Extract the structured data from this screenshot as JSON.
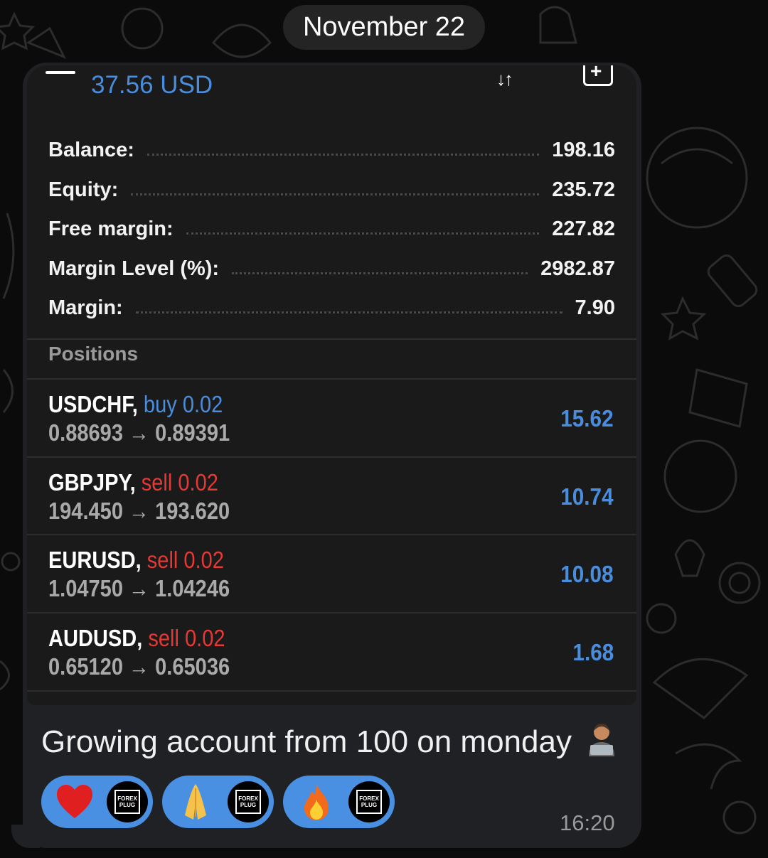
{
  "date_separator": "November 22",
  "screenshot": {
    "top_balance": "37.56 USD",
    "summary": [
      {
        "label": "Balance:",
        "value": "198.16"
      },
      {
        "label": "Equity:",
        "value": "235.72"
      },
      {
        "label": "Free margin:",
        "value": "227.82"
      },
      {
        "label": "Margin Level (%):",
        "value": "2982.87"
      },
      {
        "label": "Margin:",
        "value": "7.90"
      }
    ],
    "positions_header": "Positions",
    "positions": [
      {
        "symbol": "USDCHF,",
        "side": "buy 0.02",
        "prices": "0.88693 → 0.89391",
        "profit": "15.62"
      },
      {
        "symbol": "GBPJPY,",
        "side": "sell 0.02",
        "prices": "194.450 → 193.620",
        "profit": "10.74"
      },
      {
        "symbol": "EURUSD,",
        "side": "sell 0.02",
        "prices": "1.04750 → 1.04246",
        "profit": "10.08"
      },
      {
        "symbol": "AUDUSD,",
        "side": "sell 0.02",
        "prices": "0.65120 → 0.65036",
        "profit": "1.68"
      }
    ]
  },
  "message": {
    "caption": "Growing account from 100 on monday",
    "time": "16:20"
  },
  "reactions": [
    {
      "emoji": "❤️",
      "icon": "heart-icon"
    },
    {
      "emoji": "🙏",
      "icon": "folded-hands-icon"
    },
    {
      "emoji": "🔥",
      "icon": "fire-icon"
    }
  ],
  "reaction_avatar_text": [
    "FOREX",
    "PLUG"
  ],
  "colors": {
    "accent_blue": "#4a8ddd",
    "sell_red": "#e53935",
    "reaction_bg": "#4a90e2",
    "bubble_bg": "#202124"
  }
}
